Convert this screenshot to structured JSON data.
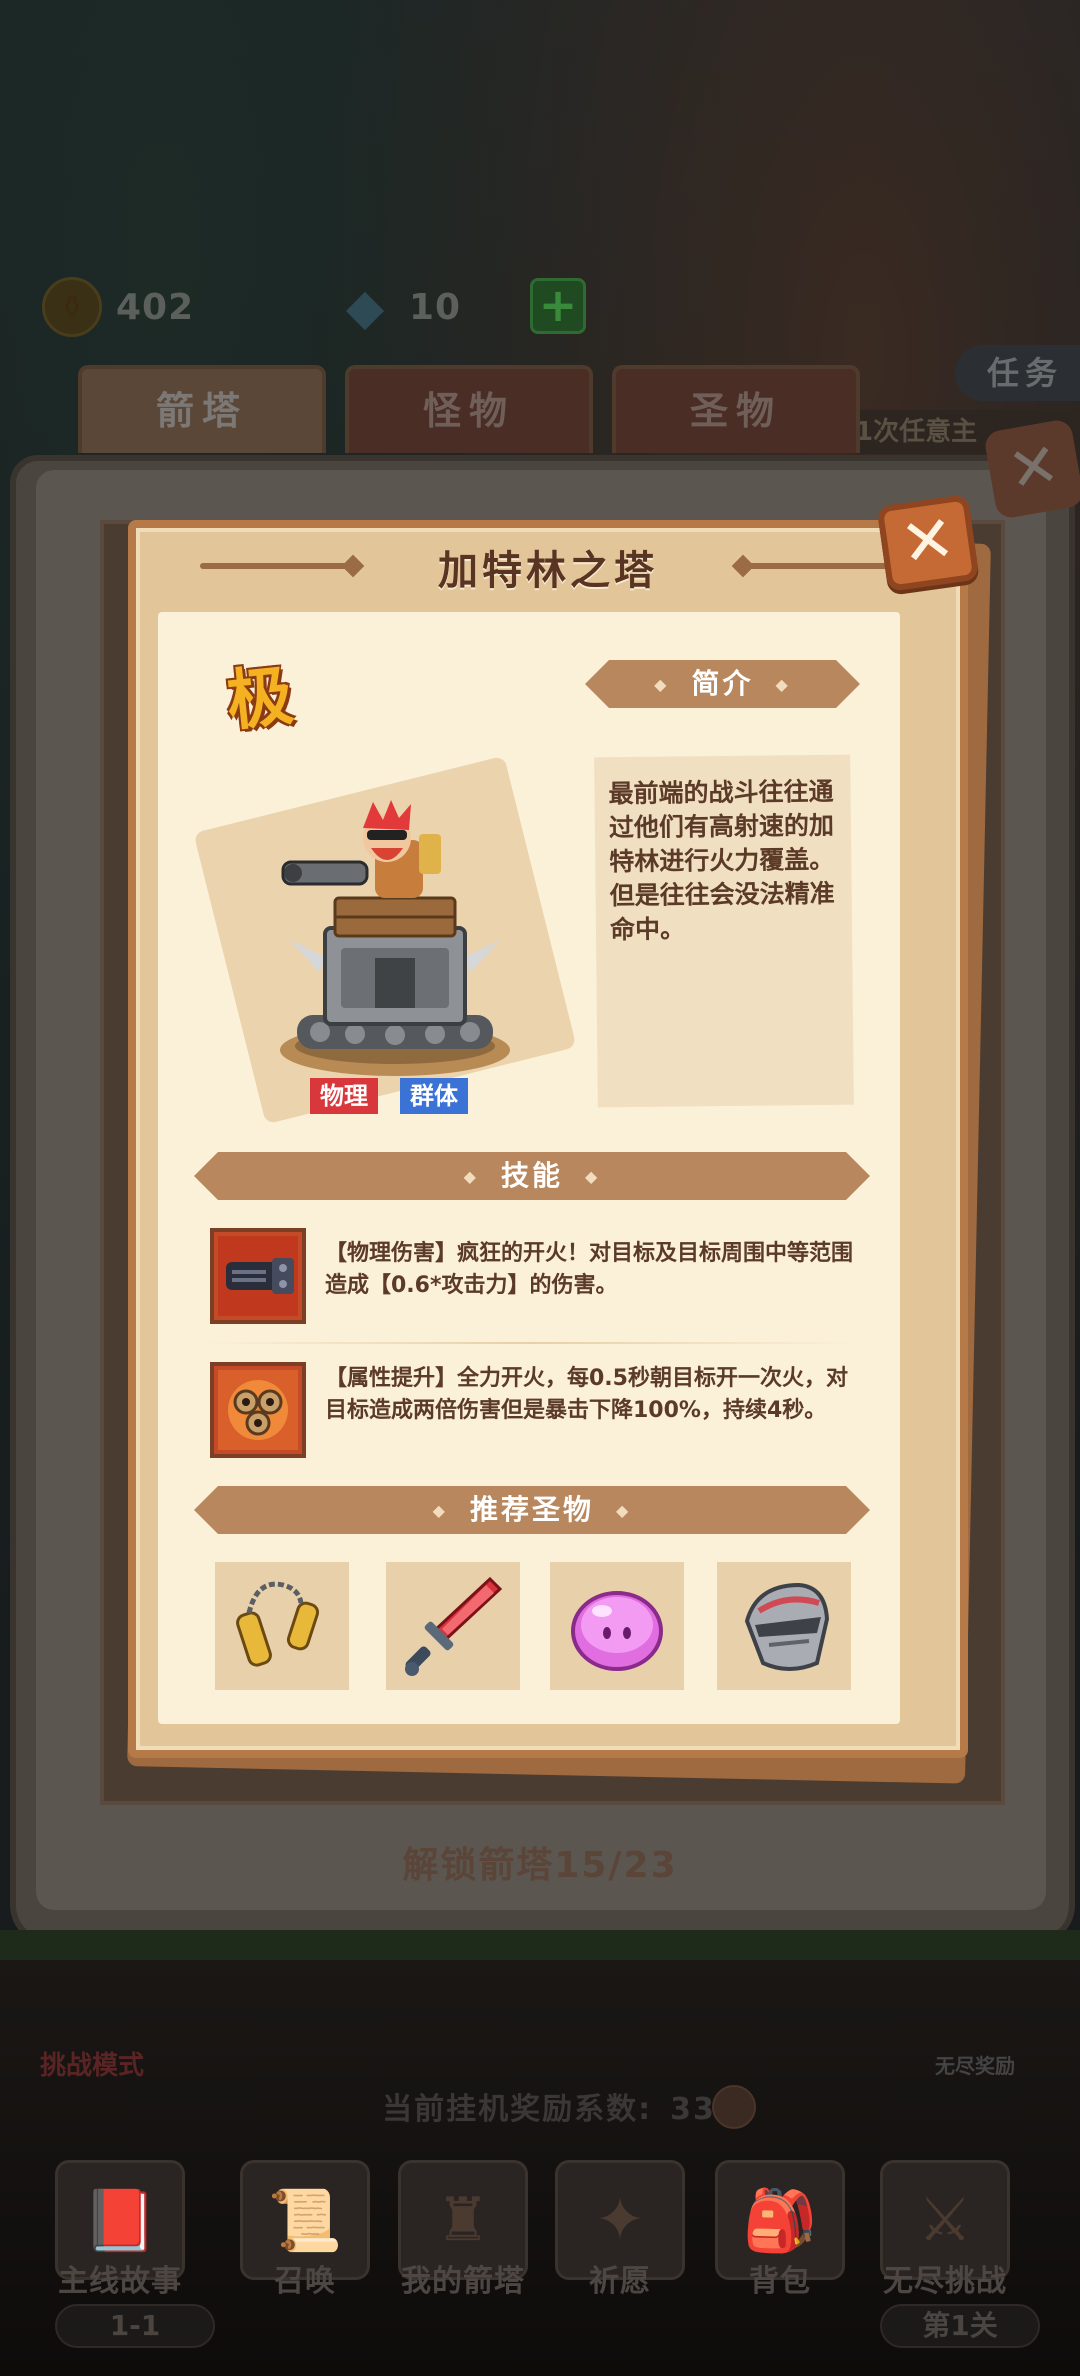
{
  "background": {
    "resources": [
      {
        "icon": "coin-icon",
        "value": "402"
      },
      {
        "icon": "gem-icon",
        "value": "10"
      }
    ],
    "task_tab": "任务",
    "task_desc": "1次任意主",
    "tabs": [
      {
        "label": "箭塔",
        "selected": true
      },
      {
        "label": "怪物",
        "selected": false
      },
      {
        "label": "圣物",
        "selected": false
      }
    ],
    "unlock_text": "解锁箭塔15/23",
    "challenge_mode": "挑战模式",
    "endless_reward": "无尽奖励",
    "idle_reward_label": "当前挂机奖励系数:",
    "idle_reward_value": "33",
    "nav": [
      {
        "label": "主线故事",
        "sub": "1-1",
        "icon": "book-icon"
      },
      {
        "label": "召唤",
        "sub": "",
        "icon": "scroll-icon"
      },
      {
        "label": "我的箭塔",
        "sub": "",
        "icon": "tower-icon"
      },
      {
        "label": "祈愿",
        "sub": "",
        "icon": "star-icon"
      },
      {
        "label": "背包",
        "sub": "",
        "icon": "bag-icon"
      },
      {
        "label": "无尽挑战",
        "sub": "第1关",
        "icon": "wings-icon"
      }
    ]
  },
  "popup": {
    "title": "加特林之塔",
    "rarity": "极",
    "tags": [
      "物理",
      "群体"
    ],
    "intro_header": "简介",
    "intro_text": "最前端的战斗往往通过他们有高射速的加特林进行火力覆盖。但是往往会没法精准命中。",
    "skills_header": "技能",
    "skills": [
      {
        "icon": "gatling-skill-icon",
        "text": "【物理伤害】疯狂的开火！对目标及目标周围中等范围造成【0.6*攻击力】的伤害。"
      },
      {
        "icon": "triple-barrel-skill-icon",
        "text": "【属性提升】全力开火，每0.5秒朝目标开一次火，对目标造成两倍伤害但是暴击下降100%，持续4秒。"
      }
    ],
    "relics_header": "推荐圣物",
    "relics": [
      {
        "icon": "nunchaku-icon"
      },
      {
        "icon": "ruby-sword-icon"
      },
      {
        "icon": "pink-slime-icon"
      },
      {
        "icon": "knight-helmet-icon"
      }
    ]
  },
  "colors": {
    "card_border": "#b57a47",
    "card_fill": "#e2c69a",
    "page_fill": "#fbf0d8",
    "banner": "#b8875e",
    "close_button": "#c56a35",
    "tag_physical": "#d8383c",
    "tag_group": "#3a72d6",
    "rarity": "#f4b121"
  }
}
